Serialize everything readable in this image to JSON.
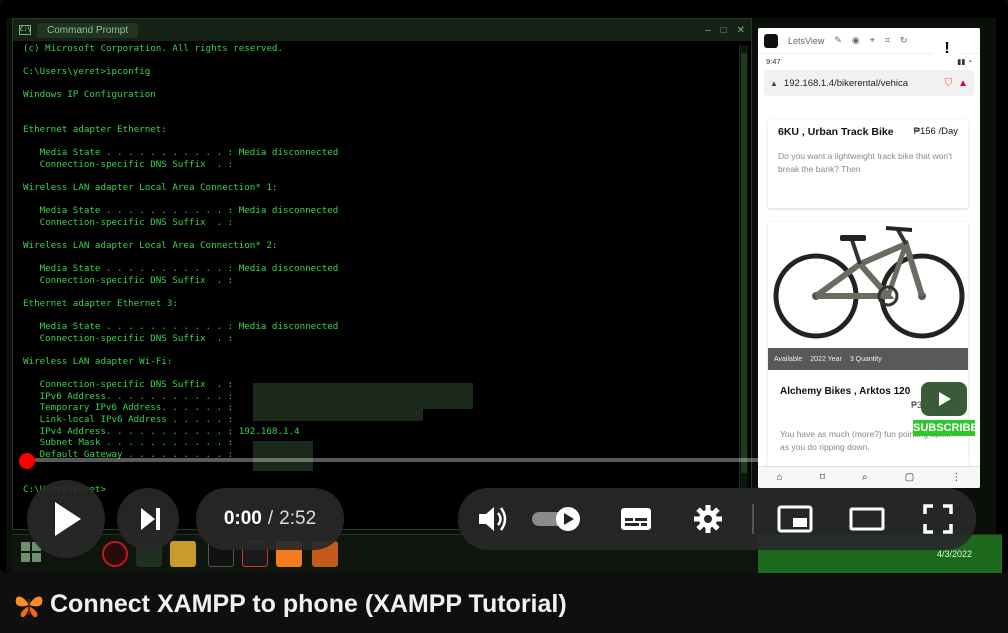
{
  "video": {
    "title": "Connect XAMPP to phone (XAMPP Tutorial)",
    "current_time": "0:00",
    "separator": "/",
    "duration": "2:52",
    "progress_fraction": 0.0
  },
  "cmd": {
    "title": "Command Prompt",
    "lines": [
      "(c) Microsoft Corporation. All rights reserved.",
      "",
      "C:\\Users\\yeret>ipconfig",
      "",
      "Windows IP Configuration",
      "",
      "",
      "Ethernet adapter Ethernet:",
      "",
      "   Media State . . . . . . . . . . . : Media disconnected",
      "   Connection-specific DNS Suffix  . :",
      "",
      "Wireless LAN adapter Local Area Connection* 1:",
      "",
      "   Media State . . . . . . . . . . . : Media disconnected",
      "   Connection-specific DNS Suffix  . :",
      "",
      "Wireless LAN adapter Local Area Connection* 2:",
      "",
      "   Media State . . . . . . . . . . . : Media disconnected",
      "   Connection-specific DNS Suffix  . :",
      "",
      "Ethernet adapter Ethernet 3:",
      "",
      "   Media State . . . . . . . . . . . : Media disconnected",
      "   Connection-specific DNS Suffix  . :",
      "",
      "Wireless LAN adapter Wi-Fi:",
      "",
      "   Connection-specific DNS Suffix  . :",
      "   IPv6 Address. . . . . . . . . . . :",
      "   Temporary IPv6 Address. . . . . . :",
      "   Link-local IPv6 Address . . . . . :",
      "   IPv4 Address. . . . . . . . . . . : 192.168.1.4",
      "   Subnet Mask . . . . . . . . . . . :",
      "   Default Gateway . . . . . . . . . :",
      "",
      "",
      "C:\\Users\\yeret>"
    ]
  },
  "phone": {
    "app_name": "LetsView",
    "status_time": "9:47",
    "url": "192.168.1.4/bikerental/vehica",
    "card1": {
      "title": "6KU , Urban Track Bike",
      "price": "₱156 /Day",
      "desc": "Do you want a lightweight track bike that won't break the bank? Then"
    },
    "card2": {
      "badge_available": "Available",
      "badge_year": "2022 Year",
      "badge_qty": "3 Quantity",
      "title": "Alchemy Bikes , Arktos 120",
      "price": "₱3138 /Day",
      "desc": "You have as much (more?) fun pointing uphill as you do ripping down."
    }
  },
  "subscribe_label": "SUBSCRIBE",
  "taskbar": {
    "date": "4/3/2022"
  },
  "colors": {
    "accent_red": "#ff0000",
    "cmd_green": "#39d24a",
    "tray_green": "#1d6a1d"
  }
}
